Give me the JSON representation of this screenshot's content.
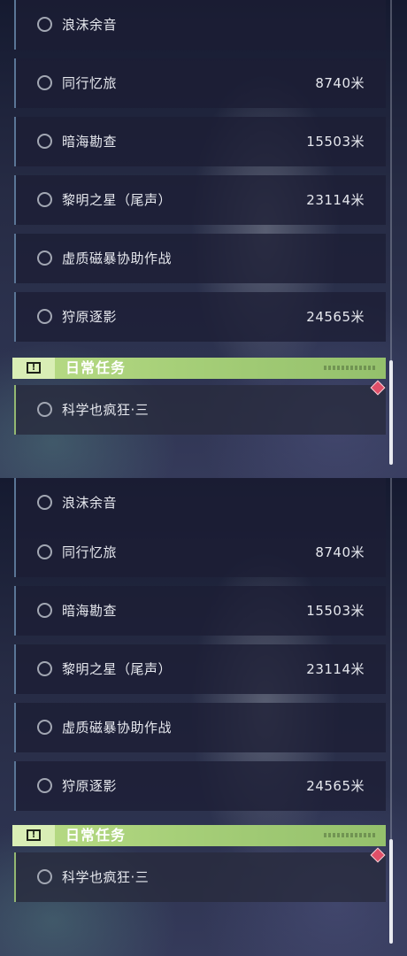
{
  "quests": [
    {
      "title": "浪沫余音",
      "distance": ""
    },
    {
      "title": "同行忆旅",
      "distance": "8740米"
    },
    {
      "title": "暗海勘查",
      "distance": "15503米"
    },
    {
      "title": "黎明之星（尾声）",
      "distance": "23114米"
    },
    {
      "title": "虚质磁暴协助作战",
      "distance": ""
    },
    {
      "title": "狩原逐影",
      "distance": "24565米"
    }
  ],
  "daily": {
    "header": "日常任务",
    "icon": "exclamation-icon",
    "quest_title": "科学也疯狂·三"
  },
  "colors": {
    "daily_accent": "#a6cf78",
    "quest_border": "#5a7596",
    "marker": "#e04f68"
  }
}
